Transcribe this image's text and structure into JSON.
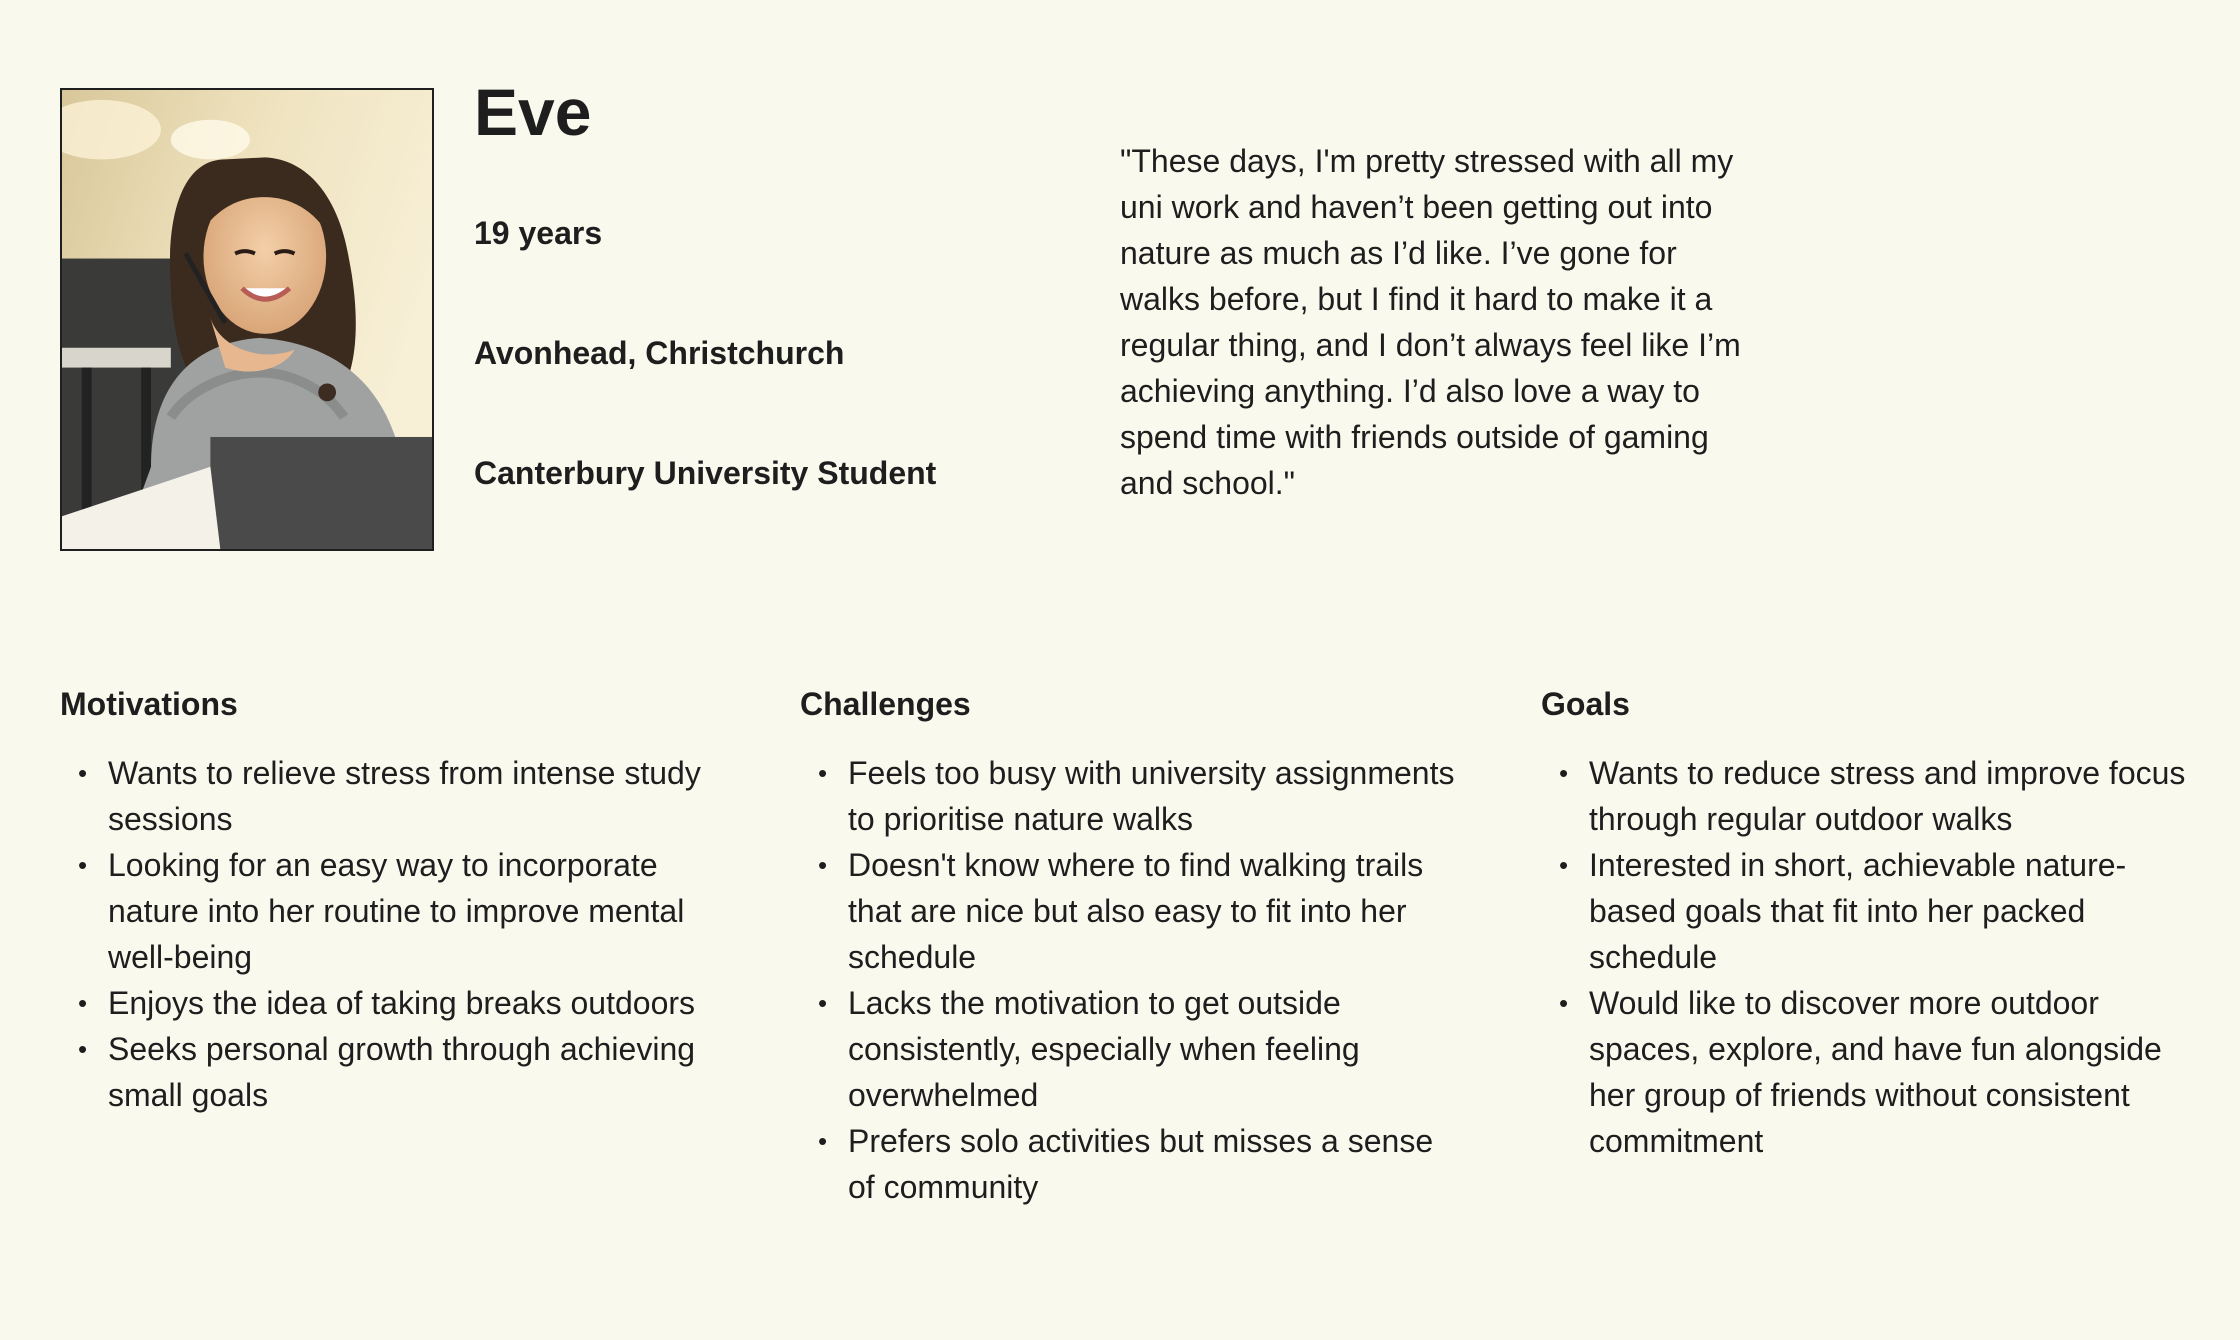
{
  "profile": {
    "name": "Eve",
    "age": "19 years",
    "location": "Avonhead, Christchurch",
    "occupation": "Canterbury University Student",
    "quote": "\"These days, I'm pretty stressed with all my uni work and haven’t been getting out into nature as much as I’d like. I’ve gone for walks before, but I find it hard to make it a regular thing, and I don’t always feel like I’m achieving anything. I’d also love a way to spend time with friends outside of gaming and school.\""
  },
  "motivations": {
    "title": "Motivations",
    "items": [
      "Wants to relieve stress from intense study sessions",
      "Looking for an easy way to incorporate nature into her routine to improve mental well-being",
      "Enjoys the idea of taking breaks outdoors",
      "Seeks personal growth through achieving small goals"
    ]
  },
  "challenges": {
    "title": "Challenges",
    "items": [
      "Feels too busy with university assignments to prioritise nature walks",
      "Doesn't know where to find walking trails that are nice but also easy to fit into her schedule",
      "Lacks the motivation to get outside consistently, especially when feeling overwhelmed",
      "Prefers solo activities but misses a sense of community"
    ]
  },
  "goals": {
    "title": "Goals",
    "items": [
      "Wants to reduce stress and improve focus through regular outdoor walks",
      "Interested in short, achievable nature-based goals that fit into her packed schedule",
      "Would like to discover more outdoor spaces, explore, and have fun alongside her group of friends without consistent commitment"
    ]
  }
}
